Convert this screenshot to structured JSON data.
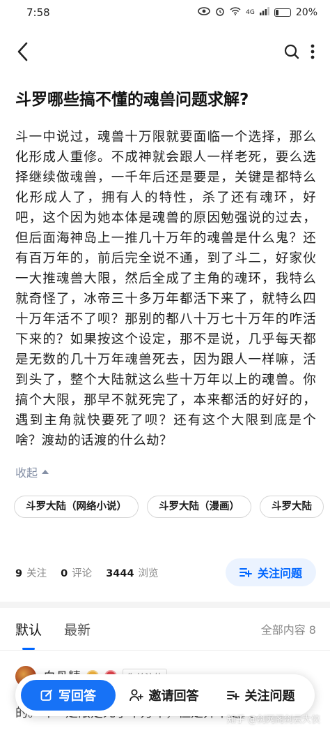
{
  "status_bar": {
    "time": "7:58",
    "network": "4G",
    "battery_percent": "20%",
    "battery_level": 0.2
  },
  "nav": {
    "back_icon": "chevron-left-icon",
    "search_icon": "search-icon",
    "more_icon": "more-vertical-icon"
  },
  "question": {
    "title": "斗罗哪些搞不懂的魂兽问题求解?",
    "body": "斗一中说过，魂兽十万限就要面临一个选择，那么化形成人重修。不成神就会跟人一样老死，要么选择继续做魂兽，一千年后还是要是，关键是都特么化形成人了，拥有人的特性，杀了还有魂环，好吧，这个因为她本体是魂兽的原因勉强说的过去，但后面海神岛上一推几十万年的魂兽是什么鬼？还有百万年的，前后完全说不通，到了斗二，好家伙一大推魂兽大限，然后全成了主角的魂环，我特么就奇怪了，冰帝三十多万年都活下来了，就特么四十万年活不了呗？那别的都八十万七十万年的咋活下来的？如果按这个设定，那不是说，几乎每天都是无数的几十万年魂兽死去，因为跟人一样嘛，活到头了，整个大陆就这么些十万年以上的魂兽。你搞个大限，那早不就死完了，本来都活的好好的，遇到主角就快要死了呗？还有这个大限到底是个啥？渡劫的话渡的什么劫？",
    "collapse_label": "收起",
    "tags": [
      "斗罗大陆（网络小说）",
      "斗罗大陆（漫画）",
      "斗罗大陆"
    ],
    "stats": {
      "followers_count": "9",
      "followers_label": "关注",
      "comments_count": "0",
      "comments_label": "评论",
      "views_count": "3444",
      "views_label": "浏览"
    },
    "follow_button": "关注问题"
  },
  "answers": {
    "sort_tabs": [
      "默认",
      "最新"
    ],
    "all_count_label": "全部内容 8",
    "first": {
      "author": "白骨精",
      "followed_tag": "你关注的",
      "preview_text": "的。斗一是限定死了十万年，但是并不是大"
    }
  },
  "action_bar": {
    "write_answer": "写回答",
    "invite_answer": "邀请回答",
    "follow_question": "关注问题"
  },
  "watermark": "知乎 @剑网阁剑云大侠",
  "colors": {
    "accent": "#0066ff",
    "write_button": "#1772f6",
    "muted": "#8590a6"
  }
}
